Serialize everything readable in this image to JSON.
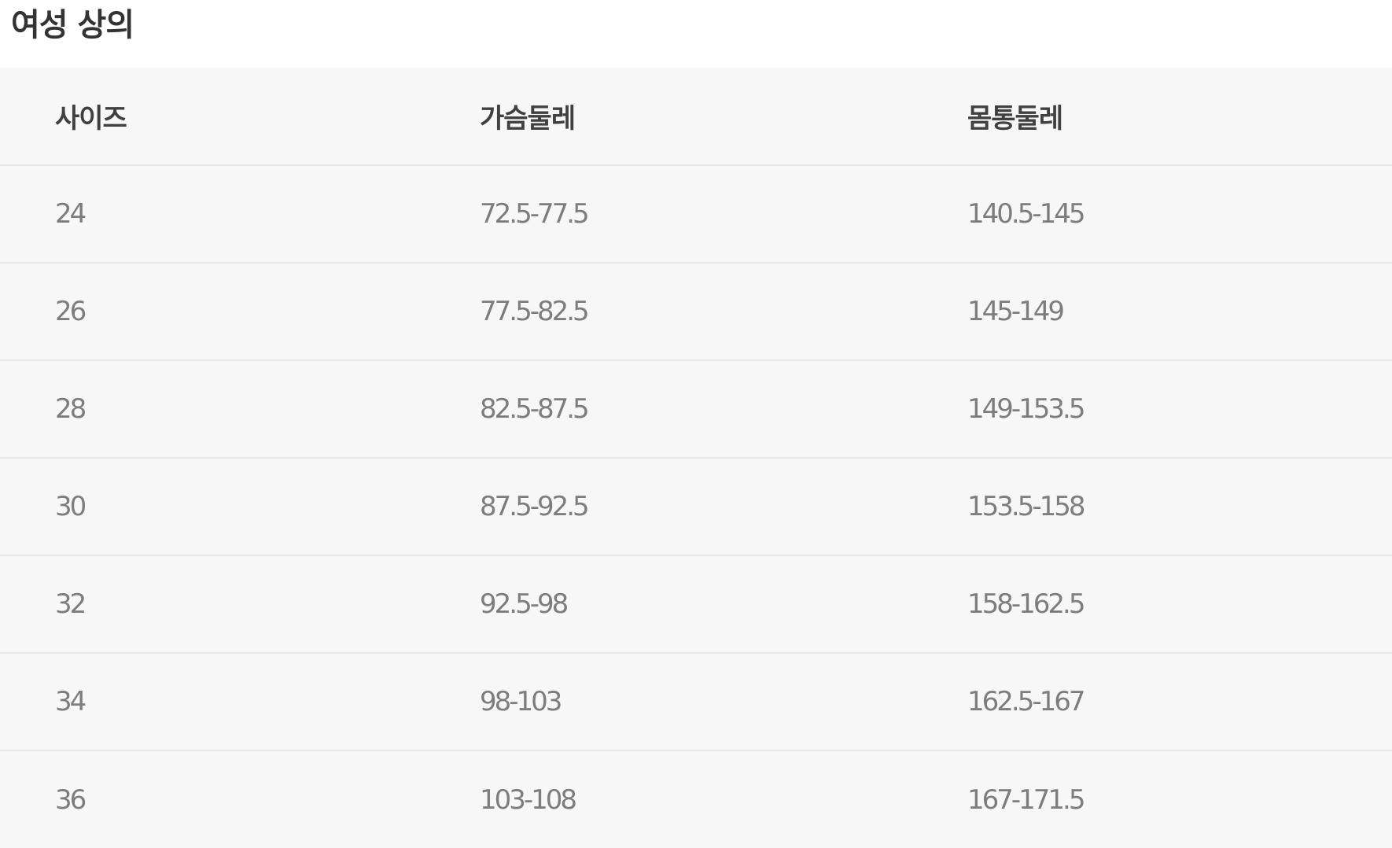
{
  "title": "여성 상의",
  "columns": [
    "사이즈",
    "가슴둘레",
    "몸통둘레"
  ],
  "rows": [
    [
      "24",
      "72.5-77.5",
      "140.5-145"
    ],
    [
      "26",
      "77.5-82.5",
      "145-149"
    ],
    [
      "28",
      "82.5-87.5",
      "149-153.5"
    ],
    [
      "30",
      "87.5-92.5",
      "153.5-158"
    ],
    [
      "32",
      "92.5-98",
      "158-162.5"
    ],
    [
      "34",
      "98-103",
      "162.5-167"
    ],
    [
      "36",
      "103-108",
      "167-171.5"
    ]
  ]
}
